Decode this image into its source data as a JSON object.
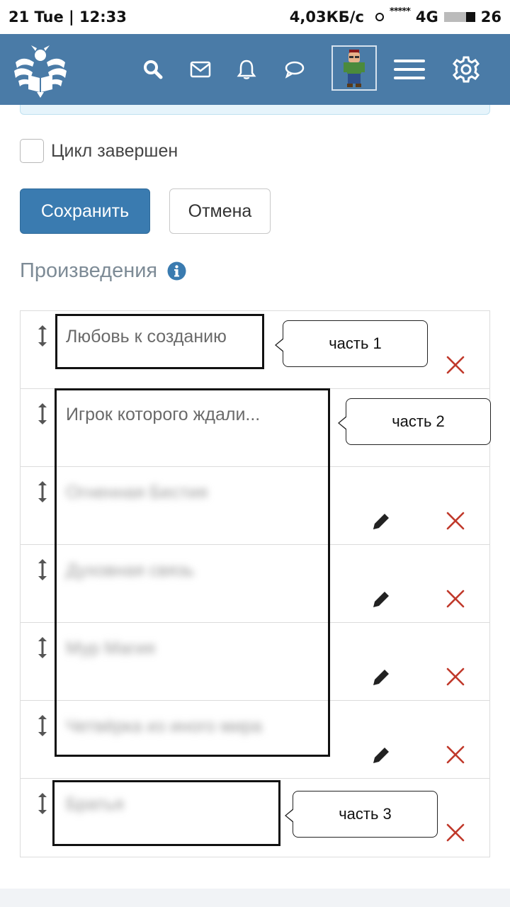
{
  "status_bar": {
    "left": "21 Tue  |  12:33",
    "net_speed": "4,03КБ/с",
    "signal_stars": "*****",
    "network": "4G",
    "battery": "26"
  },
  "header": {
    "icons": [
      "logo-eagle-book-icon",
      "search-icon",
      "mail-icon",
      "bell-icon",
      "chat-bubble-icon",
      "avatar",
      "hamburger-menu-icon",
      "gear-icon"
    ]
  },
  "form": {
    "checkbox_label": "Цикл завершен",
    "save_label": "Сохранить",
    "cancel_label": "Отмена"
  },
  "works_section": {
    "title": "Произведения",
    "items": [
      {
        "title": "Любовь к созданию",
        "blurred": false
      },
      {
        "title": "Игрок которого ждали...",
        "blurred": false
      },
      {
        "title": "Огненная Бестия",
        "blurred": true
      },
      {
        "title": "Духовная связь",
        "blurred": true
      },
      {
        "title": "Мур Магия",
        "blurred": true
      },
      {
        "title": "Четвёрка из иного мира",
        "blurred": true
      },
      {
        "title": "Братья",
        "blurred": true
      }
    ]
  },
  "annotations": {
    "part1": "часть 1",
    "part2": "часть 2",
    "part3": "часть 3"
  },
  "colors": {
    "header_bg": "#4a7ba7",
    "primary_button": "#3a7bb0",
    "delete_icon": "#c0392b"
  }
}
